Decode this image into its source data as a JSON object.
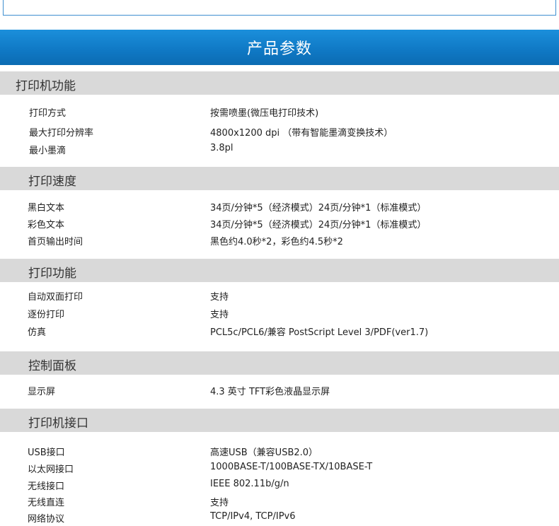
{
  "banner": {
    "title": "产品参数"
  },
  "sections": [
    {
      "title": "打印机功能",
      "rows": [
        {
          "label": "打印方式",
          "value": "按需喷墨(微压电打印技术)"
        },
        {
          "label": "最大打印分辨率",
          "value": "4800x1200 dpi （带有智能墨滴变换技术）"
        },
        {
          "label": "最小墨滴",
          "value": "3.8pl"
        }
      ]
    },
    {
      "title": "打印速度",
      "rows": [
        {
          "label": "黑白文本",
          "value": "34页/分钟*5（经济模式）24页/分钟*1（标准模式）"
        },
        {
          "label": "彩色文本",
          "value": "34页/分钟*5（经济模式）24页/分钟*1（标准模式）"
        },
        {
          "label": "首页输出时间",
          "value": "黑色约4.0秒*2，彩色约4.5秒*2"
        }
      ]
    },
    {
      "title": "打印功能",
      "rows": [
        {
          "label": "自动双面打印",
          "value": "支持"
        },
        {
          "label": "逐份打印",
          "value": "支持"
        },
        {
          "label": "仿真",
          "value": "PCL5c/PCL6/兼容 PostScript Level 3/PDF(ver1.7)"
        }
      ]
    },
    {
      "title": "控制面板",
      "rows": [
        {
          "label": "显示屏",
          "value": "4.3 英寸 TFT彩色液晶显示屏"
        }
      ]
    },
    {
      "title": "打印机接口",
      "rows": [
        {
          "label": "USB接口",
          "value": "高速USB（兼容USB2.0）"
        },
        {
          "label": "以太网接口",
          "value": "1000BASE-T/100BASE-TX/10BASE-T"
        },
        {
          "label": "无线接口",
          "value": "IEEE 802.11b/g/n"
        },
        {
          "label": "无线直连",
          "value": "支持"
        },
        {
          "label": "网络协议",
          "value": "TCP/IPv4, TCP/IPv6"
        }
      ]
    }
  ]
}
